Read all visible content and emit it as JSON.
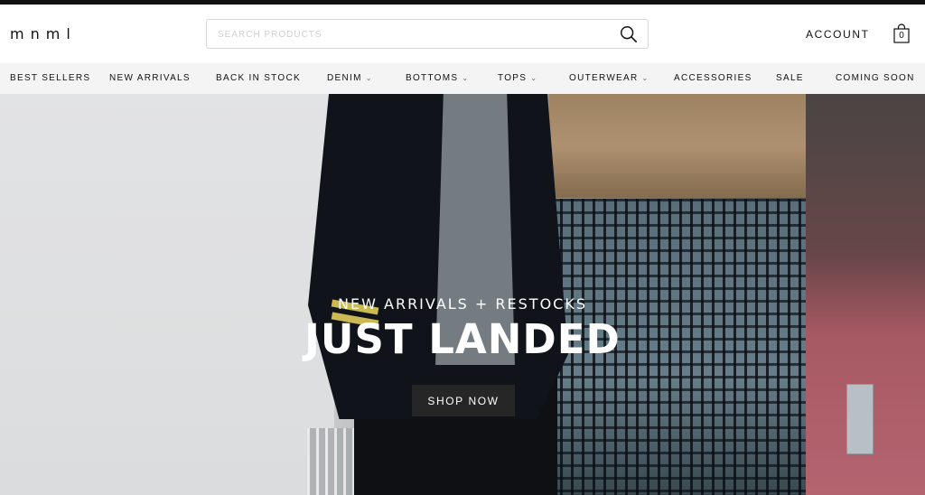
{
  "brand": {
    "logo": "mnml"
  },
  "search": {
    "placeholder": "SEARCH PRODUCTS",
    "value": ""
  },
  "header": {
    "account_label": "ACCOUNT",
    "cart_count": "0"
  },
  "nav": {
    "items": [
      {
        "label": "BEST SELLERS",
        "dropdown": false
      },
      {
        "label": "NEW ARRIVALS",
        "dropdown": false
      },
      {
        "label": "BACK IN STOCK",
        "dropdown": false
      },
      {
        "label": "DENIM",
        "dropdown": true
      },
      {
        "label": "BOTTOMS",
        "dropdown": true
      },
      {
        "label": "TOPS",
        "dropdown": true
      },
      {
        "label": "OUTERWEAR",
        "dropdown": true
      },
      {
        "label": "ACCESSORIES",
        "dropdown": false
      },
      {
        "label": "SALE",
        "dropdown": false
      },
      {
        "label": "COMING SOON",
        "dropdown": false
      }
    ],
    "dropdown_glyph": "⌄"
  },
  "hero": {
    "subtitle": "NEW ARRIVALS + RESTOCKS",
    "title": "JUST LANDED",
    "cta_label": "SHOP NOW"
  },
  "icons": {
    "search": "search-icon",
    "cart": "shopping-bag-icon",
    "chevron": "chevron-down-icon"
  },
  "colors": {
    "text": "#111111",
    "nav_background": "#f4f4f4",
    "button": "#262626",
    "top_bar": "#111111"
  }
}
